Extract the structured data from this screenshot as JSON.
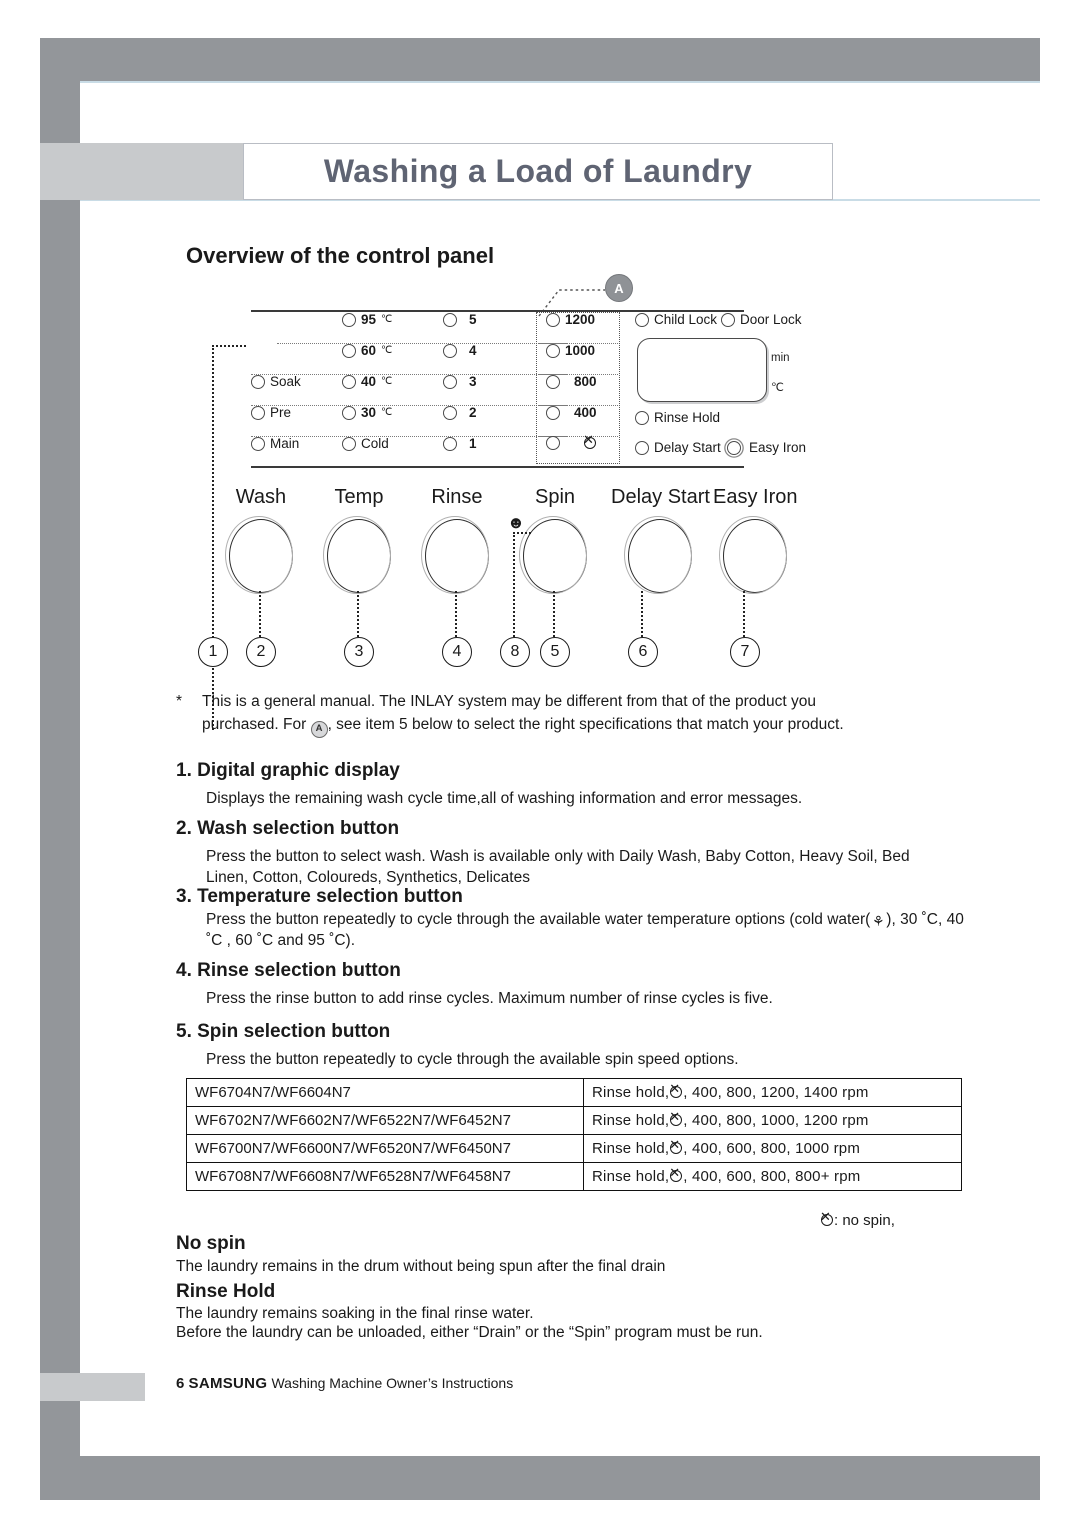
{
  "page": {
    "title": "Washing a Load of Laundry",
    "section_heading": "Overview of the control panel"
  },
  "control_panel": {
    "callout_label": "A",
    "columns": {
      "wash": [
        "Soak",
        "Pre",
        "Main"
      ],
      "temp": [
        "95",
        "60",
        "40",
        "30",
        "Cold"
      ],
      "temp_unit": "℃",
      "rinse": [
        "5",
        "4",
        "3",
        "2",
        "1"
      ],
      "spin": [
        "1200",
        "1000",
        "800",
        "400",
        "no-spin-icon"
      ]
    },
    "status_lamps": {
      "child_lock": "Child Lock",
      "door_lock": "Door Lock",
      "rinse_hold": "Rinse Hold",
      "delay_start": "Delay Start",
      "easy_iron": "Easy Iron"
    },
    "display_units": {
      "minutes": "min",
      "celsius": "℃"
    },
    "dials": [
      {
        "label": "Wash",
        "number": "2"
      },
      {
        "label": "Temp",
        "number": "3"
      },
      {
        "label": "Rinse",
        "number": "4"
      },
      {
        "label": "Spin",
        "number": "5"
      },
      {
        "label": "Delay Start",
        "number": "6"
      },
      {
        "label": "Easy Iron",
        "number": "7"
      }
    ],
    "display_callout_number": "1",
    "baby_callout_number": "8"
  },
  "note": {
    "marker": "*",
    "line1": "This is a general manual. The INLAY system may be different from that of the product you",
    "line2_pre": "purchased. For ",
    "line2_badge": "A",
    "line2_post": ", see item 5 below to select the right specifications that match your product."
  },
  "items": [
    {
      "title": "1. Digital graphic display",
      "body": "Displays the remaining wash cycle time,all of washing information and error messages."
    },
    {
      "title": "2. Wash selection button",
      "body": "Press the button to select wash. Wash is available only with Daily Wash, Baby Cotton, Heavy Soil, Bed Linen, Cotton, Coloureds, Synthetics, Delicates"
    },
    {
      "title": "3. Temperature selection button",
      "body_pre": "Press the button  repeatedly to cycle through the available water temperature options  (cold water(",
      "body_post": "), 30 ˚C, 40 ˚C , 60 ˚C and 95 ˚C)."
    },
    {
      "title": "4. Rinse selection button",
      "body": "Press the rinse button to add rinse cycles. Maximum number of rinse cycles is five."
    },
    {
      "title": "5. Spin selection button",
      "body": "Press the button repeatedly to cycle through the available spin speed options."
    }
  ],
  "spec_table": {
    "rows": [
      {
        "models": "WF6704N7/WF6604N7",
        "speeds_pre": "Rinse hold,",
        "speeds_post": ",  400,  800,  1200,  1400 rpm"
      },
      {
        "models": "WF6702N7/WF6602N7/WF6522N7/WF6452N7",
        "speeds_pre": "Rinse hold,",
        "speeds_post": ",  400,  800,  1000,  1200 rpm"
      },
      {
        "models": "WF6700N7/WF6600N7/WF6520N7/WF6450N7",
        "speeds_pre": "Rinse hold,",
        "speeds_post": ",  400,  600,  800,  1000 rpm"
      },
      {
        "models": "WF6708N7/WF6608N7/WF6528N7/WF6458N7",
        "speeds_pre": "Rinse hold,",
        "speeds_post": ",  400,  600,  800,  800+ rpm"
      }
    ],
    "legend": ": no spin,"
  },
  "subsections": [
    {
      "title": "No spin",
      "body": "The laundry remains in the drum without being spun after the final drain"
    },
    {
      "title": "Rinse Hold",
      "line1": "The laundry remains soaking in the final rinse water.",
      "line2": "Before the laundry can be unloaded, either “Drain” or the “Spin” program must be run."
    }
  ],
  "footer": {
    "page_number": "6",
    "brand": "SAMSUNG",
    "subtitle": "Washing Machine Owner’s Instructions"
  }
}
